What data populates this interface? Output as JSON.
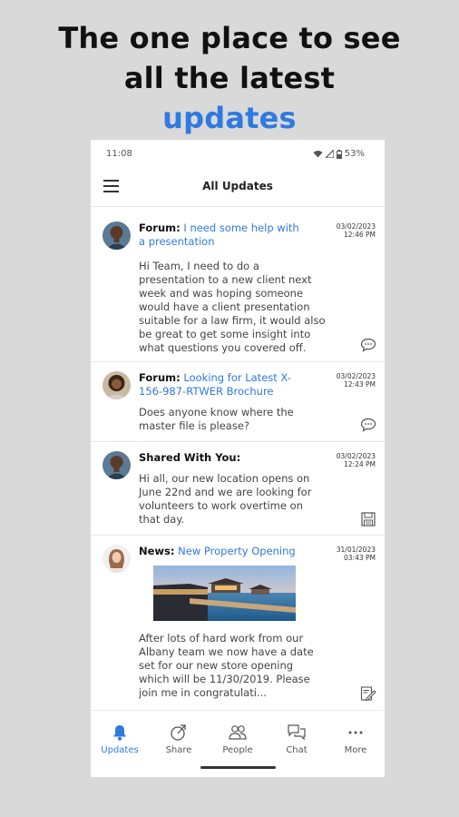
{
  "promo": {
    "line1": "The one place to see",
    "line2": "all the latest",
    "line3": "updates"
  },
  "status_bar": {
    "time": "11:08",
    "battery": "53%"
  },
  "app_bar": {
    "title": "All Updates"
  },
  "feed": [
    {
      "label": "Forum:",
      "link": "I need some help with a presentation",
      "date": "03/02/2023",
      "time": "12:46 PM",
      "body": "Hi Team, I need to do a presentation to a new client next week and was hoping someone would have a client presentation suitable for a law firm, it would also be great to get some insight into what questions you covered off.",
      "action_icon": "comment-icon"
    },
    {
      "label": "Forum:",
      "link": "Looking for Latest X-156-987-RTWER Brochure",
      "date": "03/02/2023",
      "time": "12:43 PM",
      "body": "Does anyone know where the master file is please?",
      "action_icon": "comment-icon"
    },
    {
      "label": "Shared With You:",
      "link": "",
      "date": "03/02/2023",
      "time": "12:24 PM",
      "body": "Hi all, our new location opens on June 22nd and we are looking for volunteers to work overtime on that day.",
      "action_icon": "save-icon"
    },
    {
      "label": "News:",
      "link": "New Property Opening",
      "date": "31/01/2023",
      "time": "03:43 PM",
      "body": "After lots of hard work from our Albany team we now have a date set for our new store opening which will be 11/30/2019. Please join me in congratulati...",
      "action_icon": "edit-note-icon"
    }
  ],
  "tabs": [
    {
      "label": "Updates",
      "icon": "bell-icon",
      "active": true
    },
    {
      "label": "Share",
      "icon": "share-icon",
      "active": false
    },
    {
      "label": "People",
      "icon": "people-icon",
      "active": false
    },
    {
      "label": "Chat",
      "icon": "chat-icon",
      "active": false
    },
    {
      "label": "More",
      "icon": "more-icon",
      "active": false
    }
  ],
  "colors": {
    "accent": "#2f7ae0",
    "background": "#d9d9d9"
  }
}
